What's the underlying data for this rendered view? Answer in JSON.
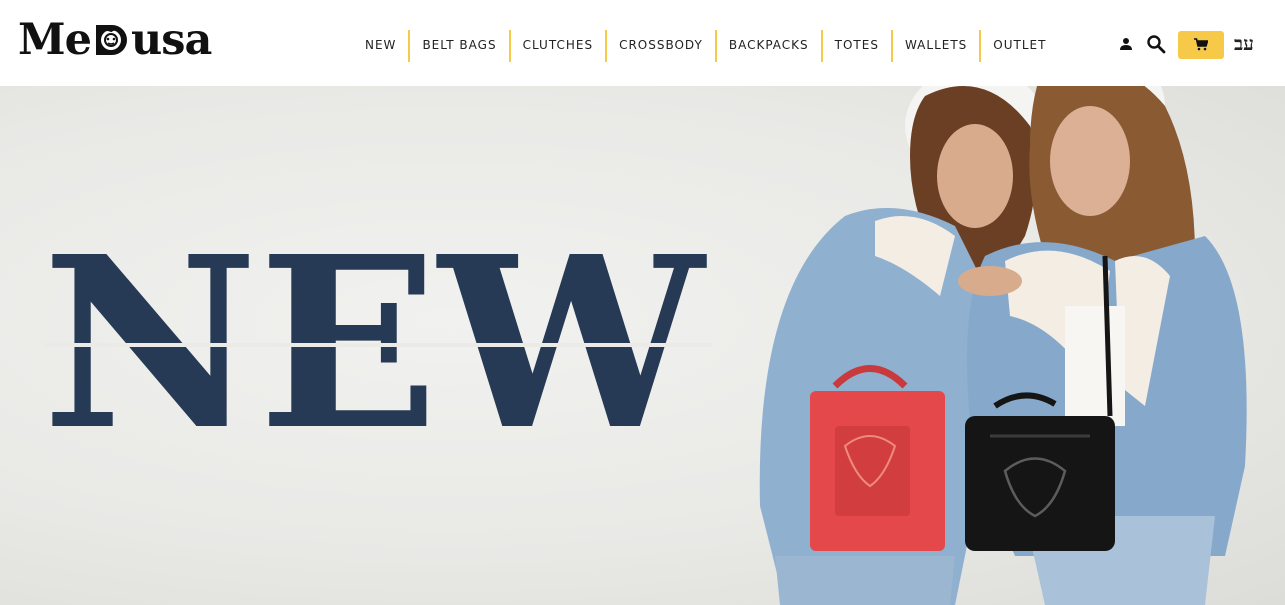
{
  "brand": {
    "name": "MeDusa",
    "left": "Me",
    "right": "usa"
  },
  "nav": {
    "items": [
      {
        "label": "NEW"
      },
      {
        "label": "BELT BAGS"
      },
      {
        "label": "CLUTCHES"
      },
      {
        "label": "CROSSBODY"
      },
      {
        "label": "BACKPACKS"
      },
      {
        "label": "TOTES"
      },
      {
        "label": "WALLETS"
      },
      {
        "label": "OUTLET"
      }
    ]
  },
  "header_icons": {
    "account": "user-icon",
    "search": "search-icon",
    "cart": "cart-icon",
    "language_label": "עב"
  },
  "hero": {
    "title": "NEW",
    "title_color": "#263a55"
  },
  "colors": {
    "accent": "#f7c948",
    "bag_red": "#e5484a",
    "bag_black": "#151515",
    "denim": "#8fb0cf"
  }
}
